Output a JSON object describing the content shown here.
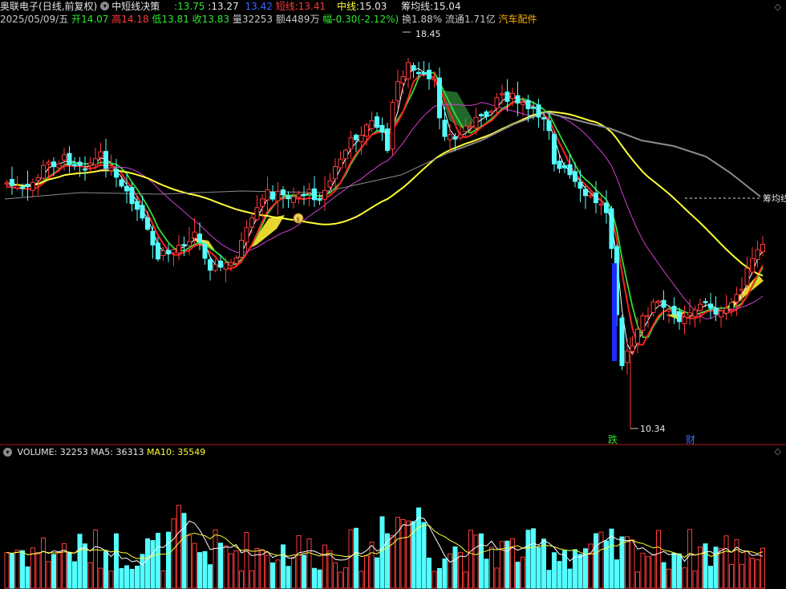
{
  "header": {
    "stock_name": "奥联电子",
    "period": "(日线,前复权)",
    "indicator_name": "中短线决策",
    "ind_val1": ":13.75",
    "ind_val2": ":13.27",
    "ind_val3": "13.42",
    "short_label": "短线:",
    "short_value": "13.41",
    "mid_label": "中线:",
    "mid_value": "15.03",
    "chip_label": "筹均线:",
    "chip_value": "15.04",
    "date": "2025/05/09/五",
    "open_label": "开",
    "open_value": "14.07",
    "high_label": "高",
    "high_value": "14.18",
    "low_label": "低",
    "low_value": "13.81",
    "close_label": "收",
    "close_value": "13.83",
    "vol_label": "量",
    "vol_value": "32253",
    "amount_label": "额",
    "amount_value": "4489万",
    "change_label": "幅",
    "change_value": "-0.30(-2.12%)",
    "turnover_label": "换",
    "turnover_value": "1.88%",
    "float_label": "流通",
    "float_value": "1.71亿",
    "sector": "汽车配件"
  },
  "annotations": {
    "high_mark": "18.45",
    "low_mark": "10.34",
    "chip_line_label": "筹均线",
    "signal_fall": "跌",
    "signal_finance": "财",
    "coin_icon": "money-bag-icon"
  },
  "volume_header": {
    "label": "VOLUME:",
    "value": "32253",
    "ma5_label": "MA5:",
    "ma5_value": "36313",
    "ma10_label": "MA10:",
    "ma10_value": "35549"
  },
  "colors": {
    "up": "#ff3a3a",
    "down": "#54ffff",
    "ma_white": "#ffffff",
    "ma_yellow": "#ffff33",
    "ma_magenta": "#d040d0",
    "chip_gray": "#8c8c8c",
    "short_red": "#ff2020",
    "short_green": "#33dd33"
  }
}
